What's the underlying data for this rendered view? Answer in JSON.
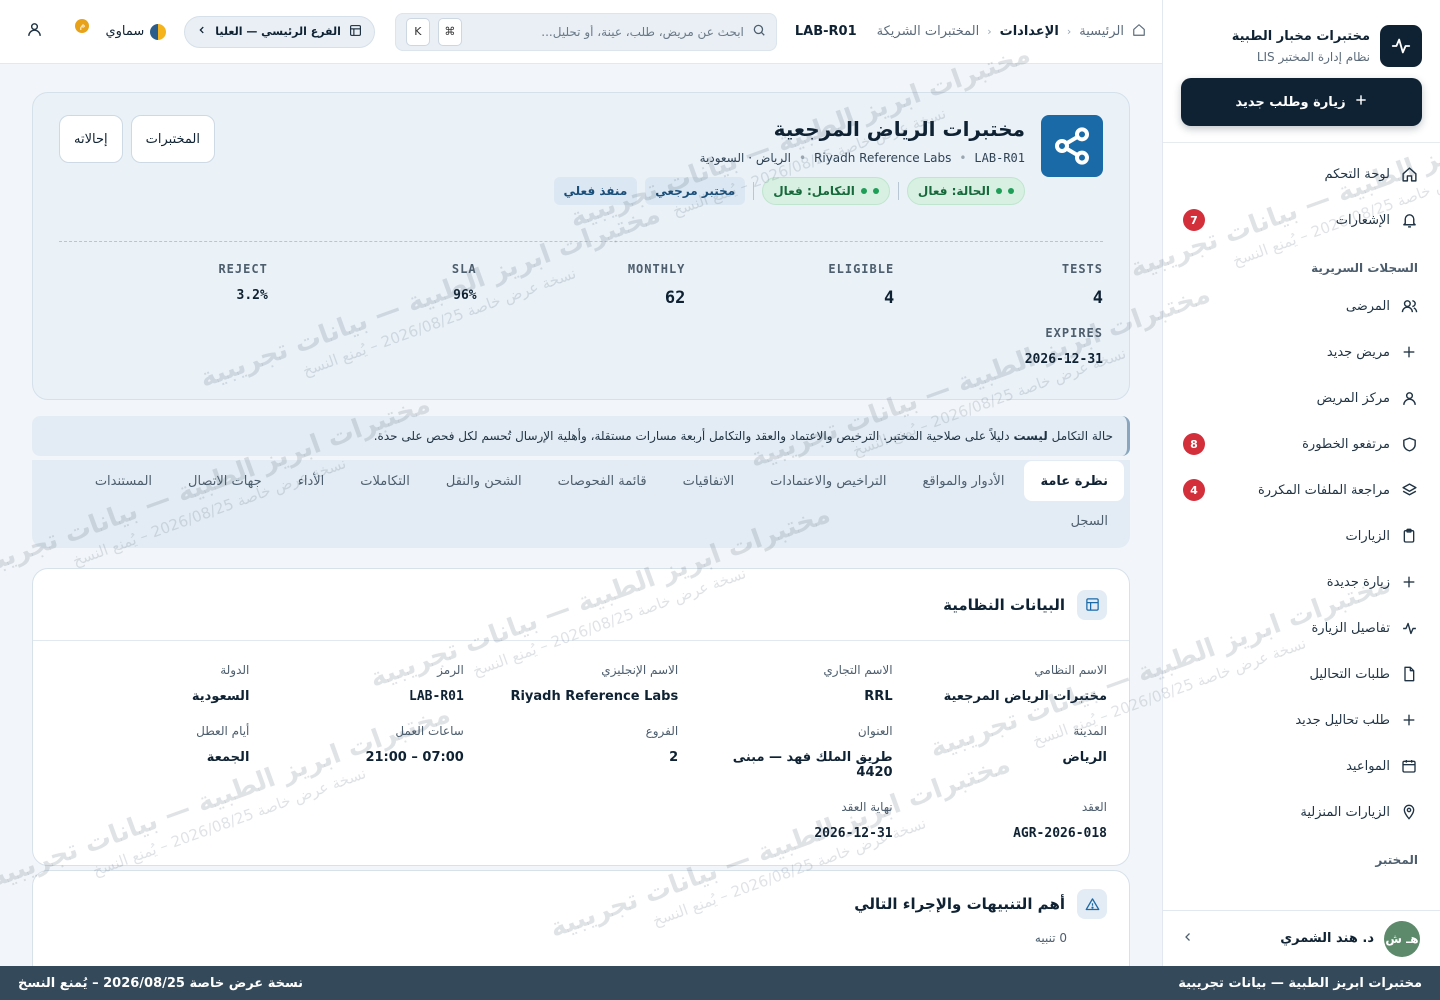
{
  "brand": {
    "name": "مختبرات مخبار الطبية",
    "subtitle": "نظام إدارة المختبر LIS",
    "logo_icon": "pulse-icon"
  },
  "sidebar": {
    "new_visit_label": "زيارة وطلب جديد",
    "items": [
      {
        "label": "لوحة التحكم",
        "icon": "home-icon"
      },
      {
        "label": "الإشعارات",
        "icon": "bell-icon",
        "badge": "7"
      }
    ],
    "section_clinical": "السجلات السريرية",
    "clinical_items": [
      {
        "label": "المرضى",
        "icon": "users-icon"
      },
      {
        "label": "مريض جديد",
        "icon": "plus-icon"
      },
      {
        "label": "مركز المريض",
        "icon": "user-icon"
      },
      {
        "label": "مرتفعو الخطورة",
        "icon": "shield-icon",
        "badge": "8"
      },
      {
        "label": "مراجعة الملفات المكررة",
        "icon": "layers-icon",
        "badge": "4"
      },
      {
        "label": "الزيارات",
        "icon": "clipboard-icon"
      },
      {
        "label": "زيارة جديدة",
        "icon": "plus-icon"
      },
      {
        "label": "تفاصيل الزيارة",
        "icon": "activity-icon"
      },
      {
        "label": "طلبات التحاليل",
        "icon": "file-icon"
      },
      {
        "label": "طلب تحاليل جديد",
        "icon": "plus-icon"
      },
      {
        "label": "المواعيد",
        "icon": "calendar-icon"
      },
      {
        "label": "الزيارات المنزلية",
        "icon": "map-pin-icon"
      }
    ],
    "section_lab": "المختبر",
    "user": {
      "name": "د. هند الشمري",
      "initials": "هـ ش"
    }
  },
  "topbar": {
    "breadcrumbs": [
      "الرئيسية",
      "الإعدادات",
      "المختبرات الشريكة"
    ],
    "current_code": "LAB-R01",
    "search_placeholder": "ابحث عن مريض، طلب، عينة، أو تحليل...",
    "kbd_1": "⌘",
    "kbd_2": "K",
    "branch_label": "الفرع الرئيسي — العليا",
    "theme_label": "سماوي",
    "notif_count": "م"
  },
  "hero": {
    "title": "مختبرات الرياض المرجعية",
    "code": "LAB-R01",
    "english_name": "Riyadh Reference Labs",
    "location": "الرياض · السعودية",
    "chips": {
      "status": "الحالة: فعال",
      "integration": "التكامل: فعال",
      "type": "مختبر مرجعي",
      "executor": "منفذ فعلي"
    },
    "buttons": {
      "labs": "المختبرات",
      "referral": "إحالاته"
    },
    "stats": [
      {
        "key": "TESTS",
        "value": "4"
      },
      {
        "key": "ELIGIBLE",
        "value": "4"
      },
      {
        "key": "MONTHLY",
        "value": "62"
      },
      {
        "key": "SLA",
        "value": "96%"
      },
      {
        "key": "REJECT",
        "value": "3.2%"
      },
      {
        "key": "EXPIRES",
        "value": "2026-12-31"
      }
    ]
  },
  "notice": {
    "pre": "حالة التكامل ",
    "bold": "ليست",
    "post": " دليلاً على صلاحية المختبر. الترخيص والاعتماد والعقد والتكامل أربعة مسارات مستقلة، وأهلية الإرسال تُحسم لكل فحص على حدة."
  },
  "tabs": [
    "نظرة عامة",
    "الأدوار والمواقع",
    "التراخيص والاعتمادات",
    "الاتفاقيات",
    "قائمة الفحوصات",
    "الشحن والنقل",
    "التكاملات",
    "الأداء",
    "جهات الاتصال",
    "المستندات"
  ],
  "tab_second_row": "السجل",
  "legal_card": {
    "title": "البيانات النظامية",
    "fields": [
      {
        "label": "الاسم النظامي",
        "value": "مختبرات الرياض المرجعية"
      },
      {
        "label": "الاسم التجاري",
        "value": "RRL"
      },
      {
        "label": "الاسم الإنجليزي",
        "value": "Riyadh Reference Labs"
      },
      {
        "label": "الرمز",
        "value": "LAB-R01"
      },
      {
        "label": "الدولة",
        "value": "السعودية"
      },
      {
        "label": "المدينة",
        "value": "الرياض"
      },
      {
        "label": "العنوان",
        "value": "طريق الملك فهد — مبنى 4420"
      },
      {
        "label": "الفروع",
        "value": "2"
      },
      {
        "label": "ساعات العمل",
        "value": "07:00 – 21:00"
      },
      {
        "label": "أيام العطل",
        "value": "الجمعة"
      },
      {
        "label": "العقد",
        "value": "AGR-2026-018"
      },
      {
        "label": "نهاية العقد",
        "value": "2026-12-31"
      }
    ]
  },
  "alerts_card": {
    "title": "أهم التنبيهات والإجراء التالي",
    "count": "0 تنبيه"
  },
  "footer": {
    "right": "مختبرات ابريز الطبية — بيانات تجريبية",
    "left": "نسخة عرض خاصة 2026/08/25 – يُمنع النسخ"
  },
  "watermark": {
    "line1": "مختبرات ابريز الطبية — بيانات تجريبية",
    "line2": "نسخة عرض خاصة 2026/08/25 – يُمنع النسخ"
  },
  "colors": {
    "primary": "#0f2233",
    "accent": "#1a6aa8",
    "success": "#1f9e57",
    "danger": "#d32f3a"
  }
}
